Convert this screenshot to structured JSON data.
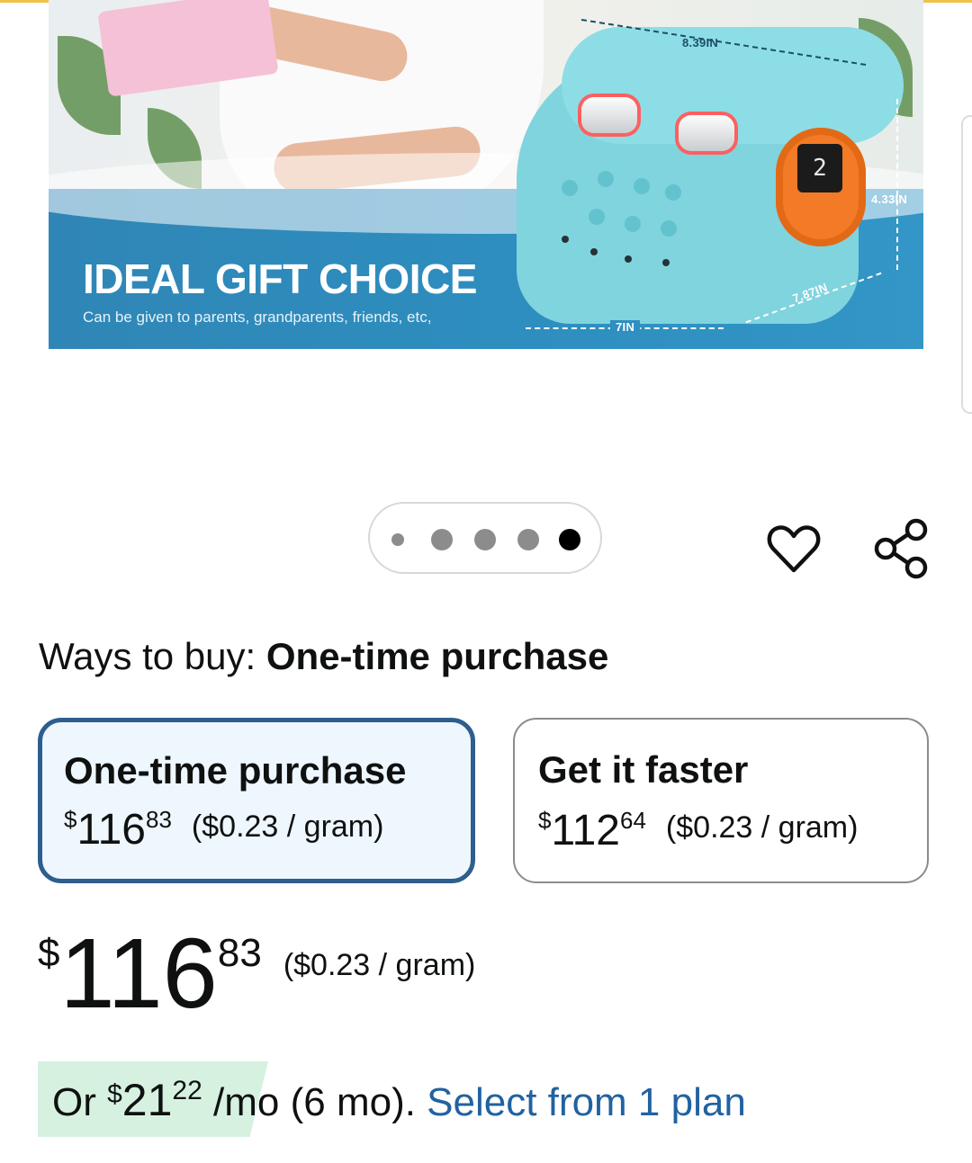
{
  "hero": {
    "title": "IDEAL GIFT CHOICE",
    "subtitle": "Can be given to parents, grandparents, friends, etc,",
    "dimensions": {
      "top": "8.39IN",
      "height": "4.33IN",
      "depth": "7.87IN",
      "width": "7IN"
    },
    "display_digit": "2"
  },
  "gallery": {
    "dot_count": 5,
    "active_index": 4
  },
  "actions": {
    "favorite_icon": "heart-icon",
    "share_icon": "share-icon"
  },
  "ways_to_buy": {
    "label": "Ways to buy:",
    "selected": "One-time purchase"
  },
  "options": [
    {
      "title": "One-time purchase",
      "currency": "$",
      "price_whole": "116",
      "price_fraction": "83",
      "unit_price": "($0.23 / gram)",
      "selected": true
    },
    {
      "title": "Get it faster",
      "currency": "$",
      "price_whole": "112",
      "price_fraction": "64",
      "unit_price": "($0.23 / gram)",
      "selected": false
    }
  ],
  "price": {
    "currency": "$",
    "whole": "116",
    "fraction": "83",
    "unit_price": "($0.23 / gram)"
  },
  "installment": {
    "prefix": "Or ",
    "currency": "$",
    "whole": "21",
    "fraction": "22",
    "suffix": " /mo (6 mo). ",
    "link": "Select from 1 plan"
  },
  "colors": {
    "selected_border": "#2d5e8e",
    "selected_bg": "#eef7fd",
    "link": "#2162a1",
    "installment_bg": "#d6f1e0",
    "banner_blue": "#2e8fc0"
  }
}
